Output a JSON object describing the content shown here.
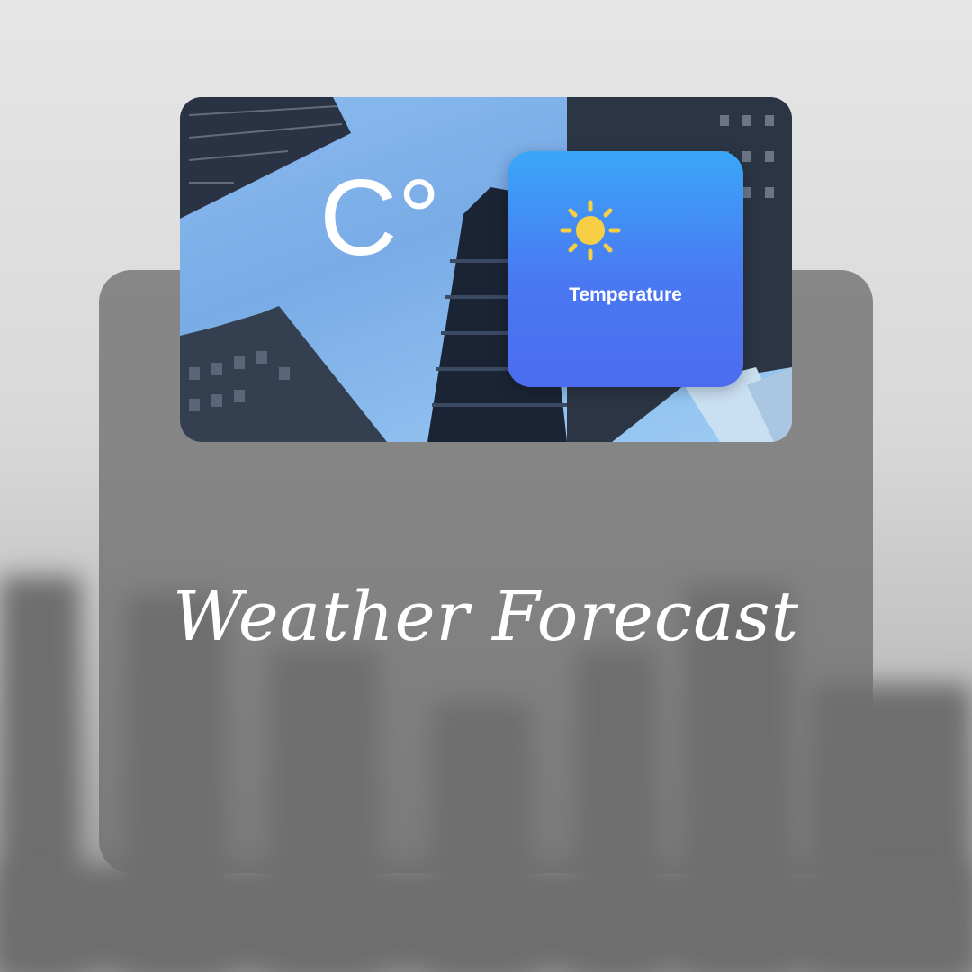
{
  "card": {
    "degree_symbol": "C°"
  },
  "widget": {
    "label": "Temperature",
    "icon": "sun-icon"
  },
  "title": "Weather Forecast",
  "colors": {
    "widget_top": "#3aa7f8",
    "widget_bottom": "#4b6cf0",
    "sun": "#f6cf45",
    "panel": "#6e6e6e"
  }
}
